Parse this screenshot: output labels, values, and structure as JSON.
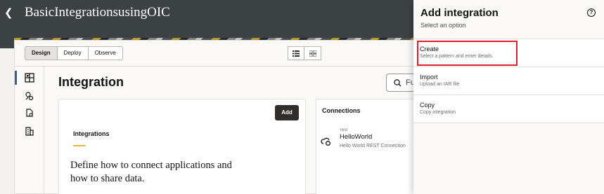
{
  "header": {
    "back_icon": "chevron-left-icon",
    "title": "BasicIntegrationsusingOIC"
  },
  "toolbar": {
    "modes": [
      "Design",
      "Deploy",
      "Observe"
    ],
    "active_mode": "Design",
    "view_icons": [
      "list-view-icon",
      "grid-view-icon"
    ]
  },
  "leftnav": {
    "items": [
      {
        "icon": "integration-icon",
        "active": true
      },
      {
        "icon": "connections-icon",
        "active": false
      },
      {
        "icon": "lookups-icon",
        "active": false
      },
      {
        "icon": "libraries-icon",
        "active": false
      }
    ]
  },
  "main": {
    "page_title": "Integration",
    "search_text": "Fu",
    "integrations_panel": {
      "add_label": "Add",
      "heading": "Integrations",
      "description": "Define how to connect applications and how to share data."
    },
    "connections_panel": {
      "heading": "Connections",
      "item": {
        "type": "rest",
        "name": "HelloWorld",
        "description": "Hello World REST Connection"
      }
    }
  },
  "drawer": {
    "title": "Add integration",
    "subtitle": "Select an option",
    "help_icon": "help-icon",
    "options": [
      {
        "title": "Create",
        "description": "Select a pattern and enter details.",
        "highlighted": true
      },
      {
        "title": "Import",
        "description": "Upload an IAR file",
        "highlighted": false
      },
      {
        "title": "Copy",
        "description": "Copy integration",
        "highlighted": false
      }
    ]
  },
  "colors": {
    "header_bg": "#3c4144",
    "accent": "#e5b43c",
    "highlight": "#e0202a",
    "primary_button": "#312d2a"
  }
}
